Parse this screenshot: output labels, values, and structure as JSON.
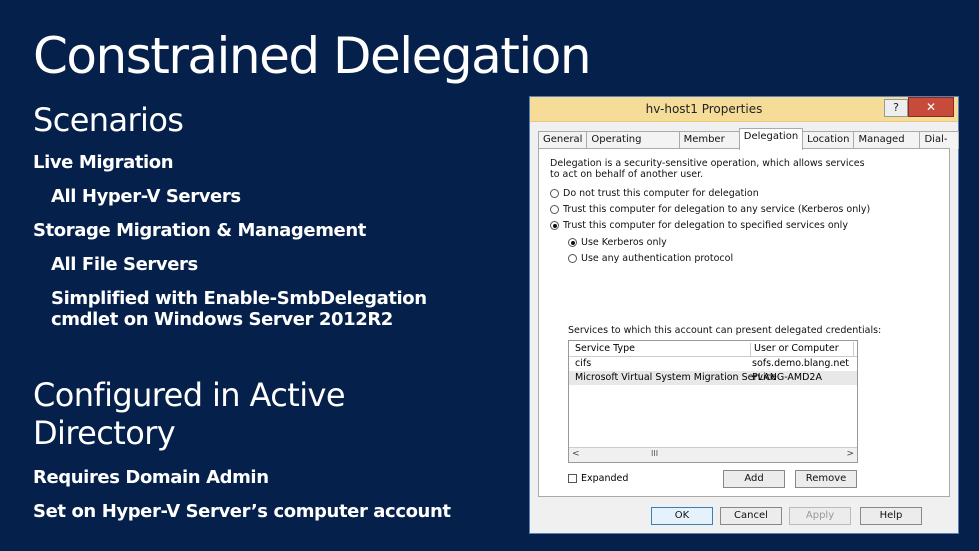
{
  "slide": {
    "title": "Constrained Delegation",
    "section1": "Scenarios",
    "live_migration": "Live Migration",
    "all_hyperv": "All Hyper-V Servers",
    "storage_migration": "Storage Migration & Management",
    "all_file_servers": "All File Servers",
    "simplified_line1": "Simplified with Enable-SmbDelegation",
    "simplified_line2": "cmdlet on Windows Server 2012R2",
    "section2_line1": "Configured in Active",
    "section2_line2": "Directory",
    "requires": "Requires Domain Admin",
    "set_on": "Set on Hyper-V Server’s computer account"
  },
  "dialog": {
    "title": "hv-host1 Properties",
    "help": "?",
    "close": "✕",
    "tabs": [
      "General",
      "Operating System",
      "Member Of",
      "Delegation",
      "Location",
      "Managed By",
      "Dial-in"
    ],
    "description": "Delegation is a security-sensitive operation, which allows services to act on behalf of another user.",
    "radio_no_trust": "Do not trust this computer for delegation",
    "radio_any": "Trust this computer for delegation to any service (Kerberos only)",
    "radio_specified": "Trust this computer for delegation to specified services only",
    "radio_kerberos": "Use Kerberos only",
    "radio_any_protocol": "Use any authentication protocol",
    "services_label": "Services to which this account can present delegated credentials:",
    "columns": [
      "Service Type",
      "User or Computer"
    ],
    "rows": [
      [
        "cifs",
        "sofs.demo.blang.net"
      ],
      [
        "Microsoft Virtual System Migration Service",
        "PLANG-AMD2A"
      ]
    ],
    "scroll_left": "<",
    "scroll_right": ">",
    "scroll_thumb": "III",
    "expanded": "Expanded",
    "add": "Add",
    "remove": "Remove",
    "ok": "OK",
    "cancel": "Cancel",
    "apply": "Apply",
    "help_btn": "Help"
  }
}
